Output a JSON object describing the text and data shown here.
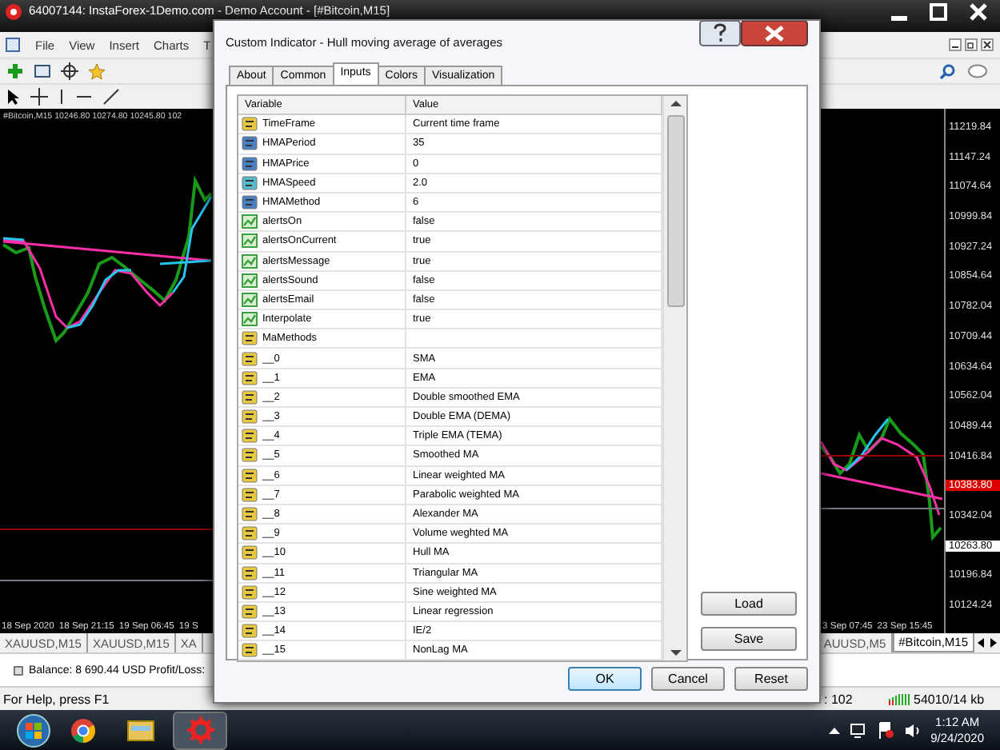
{
  "app_window": {
    "title": "64007144: InstaForex-1Demo.com - Demo Account - [#Bitcoin,M15]",
    "menu": [
      "File",
      "View",
      "Insert",
      "Charts",
      "T"
    ]
  },
  "left_chart": {
    "header": "#Bitcoin,M15  10246.80 10274.80 10245.80 102",
    "time_labels": [
      "18 Sep 2020",
      "18 Sep 21:15",
      "19 Sep 06:45",
      "19 S"
    ]
  },
  "right_chart": {
    "time_labels": [
      "3 Sep 07:45",
      "23 Sep 15:45"
    ],
    "price_labels": [
      {
        "text": "11219.84",
        "kind": "plain"
      },
      {
        "text": "11147.24",
        "kind": "plain"
      },
      {
        "text": "11074.64",
        "kind": "plain"
      },
      {
        "text": "10999.84",
        "kind": "plain"
      },
      {
        "text": "10927.24",
        "kind": "plain"
      },
      {
        "text": "10854.64",
        "kind": "plain"
      },
      {
        "text": "10782.04",
        "kind": "plain"
      },
      {
        "text": "10709.44",
        "kind": "plain"
      },
      {
        "text": "10634.64",
        "kind": "plain"
      },
      {
        "text": "10562.04",
        "kind": "plain"
      },
      {
        "text": "10489.44",
        "kind": "plain"
      },
      {
        "text": "10416.84",
        "kind": "plain"
      },
      {
        "text": "10383.80",
        "kind": "bid"
      },
      {
        "text": "10342.04",
        "kind": "plain"
      },
      {
        "text": "10263.80",
        "kind": "line"
      },
      {
        "text": "10196.84",
        "kind": "plain"
      },
      {
        "text": "10124.24",
        "kind": "plain"
      }
    ]
  },
  "chart_tabs_left": [
    {
      "label": "XAUUSD,M15",
      "selected": false
    },
    {
      "label": "XAUUSD,M15",
      "selected": false
    },
    {
      "label": "XA",
      "selected": false
    }
  ],
  "chart_tabs_right": [
    {
      "label": "AUUSD,M5",
      "selected": false
    },
    {
      "label": "#Bitcoin,M15",
      "selected": true
    }
  ],
  "terminal": {
    "balance": "Balance: 8 690.44 USD  Profit/Loss:"
  },
  "status_bar": {
    "help": "For Help, press F1",
    "bars": ": 102",
    "traffic": "54010/14 kb"
  },
  "taskbar": {
    "time": "1:12 AM",
    "date": "9/24/2020"
  },
  "dialog": {
    "title": "Custom Indicator - Hull moving average of averages",
    "tabs": [
      {
        "label": "About",
        "selected": false
      },
      {
        "label": "Common",
        "selected": false
      },
      {
        "label": "Inputs",
        "selected": true
      },
      {
        "label": "Colors",
        "selected": false
      },
      {
        "label": "Visualization",
        "selected": false
      }
    ],
    "columns": [
      "Variable",
      "Value"
    ],
    "rows": [
      {
        "kind": "string",
        "variable": "TimeFrame",
        "value": "Current time frame"
      },
      {
        "kind": "int",
        "variable": "HMAPeriod",
        "value": "35"
      },
      {
        "kind": "int",
        "variable": "HMAPrice",
        "value": "0"
      },
      {
        "kind": "double",
        "variable": "HMASpeed",
        "value": "2.0"
      },
      {
        "kind": "int",
        "variable": "HMAMethod",
        "value": "6"
      },
      {
        "kind": "bool",
        "variable": "alertsOn",
        "value": "false"
      },
      {
        "kind": "bool",
        "variable": "alertsOnCurrent",
        "value": "true"
      },
      {
        "kind": "bool",
        "variable": "alertsMessage",
        "value": "true"
      },
      {
        "kind": "bool",
        "variable": "alertsSound",
        "value": "false"
      },
      {
        "kind": "bool",
        "variable": "alertsEmail",
        "value": "false"
      },
      {
        "kind": "bool",
        "variable": "Interpolate",
        "value": "true"
      },
      {
        "kind": "string",
        "variable": "MaMethods"
      },
      {
        "kind": "string",
        "variable": "__0",
        "value": "SMA"
      },
      {
        "kind": "string",
        "variable": "__1",
        "value": "EMA"
      },
      {
        "kind": "string",
        "variable": "__2",
        "value": "Double smoothed EMA"
      },
      {
        "kind": "string",
        "variable": "__3",
        "value": "Double EMA (DEMA)"
      },
      {
        "kind": "string",
        "variable": "__4",
        "value": "Triple EMA (TEMA)"
      },
      {
        "kind": "string",
        "variable": "__5",
        "value": "Smoothed MA"
      },
      {
        "kind": "string",
        "variable": "__6",
        "value": "Linear weighted MA"
      },
      {
        "kind": "string",
        "variable": "__7",
        "value": "Parabolic weighted MA"
      },
      {
        "kind": "string",
        "variable": "__8",
        "value": "Alexander MA"
      },
      {
        "kind": "string",
        "variable": "__9",
        "value": "Volume weghted MA"
      },
      {
        "kind": "string",
        "variable": "__10",
        "value": "Hull MA"
      },
      {
        "kind": "string",
        "variable": "__11",
        "value": "Triangular MA"
      },
      {
        "kind": "string",
        "variable": "__12",
        "value": "Sine weighted MA"
      },
      {
        "kind": "string",
        "variable": "__13",
        "value": "Linear regression"
      },
      {
        "kind": "string",
        "variable": "__14",
        "value": "IE/2"
      },
      {
        "kind": "string",
        "variable": "__15",
        "value": "NonLag MA"
      }
    ],
    "side_buttons": [
      {
        "label": "Load"
      },
      {
        "label": "Save"
      }
    ],
    "buttons": [
      {
        "label": "OK",
        "default": true
      },
      {
        "label": "Cancel",
        "default": false
      },
      {
        "label": "Reset",
        "default": false
      }
    ]
  }
}
